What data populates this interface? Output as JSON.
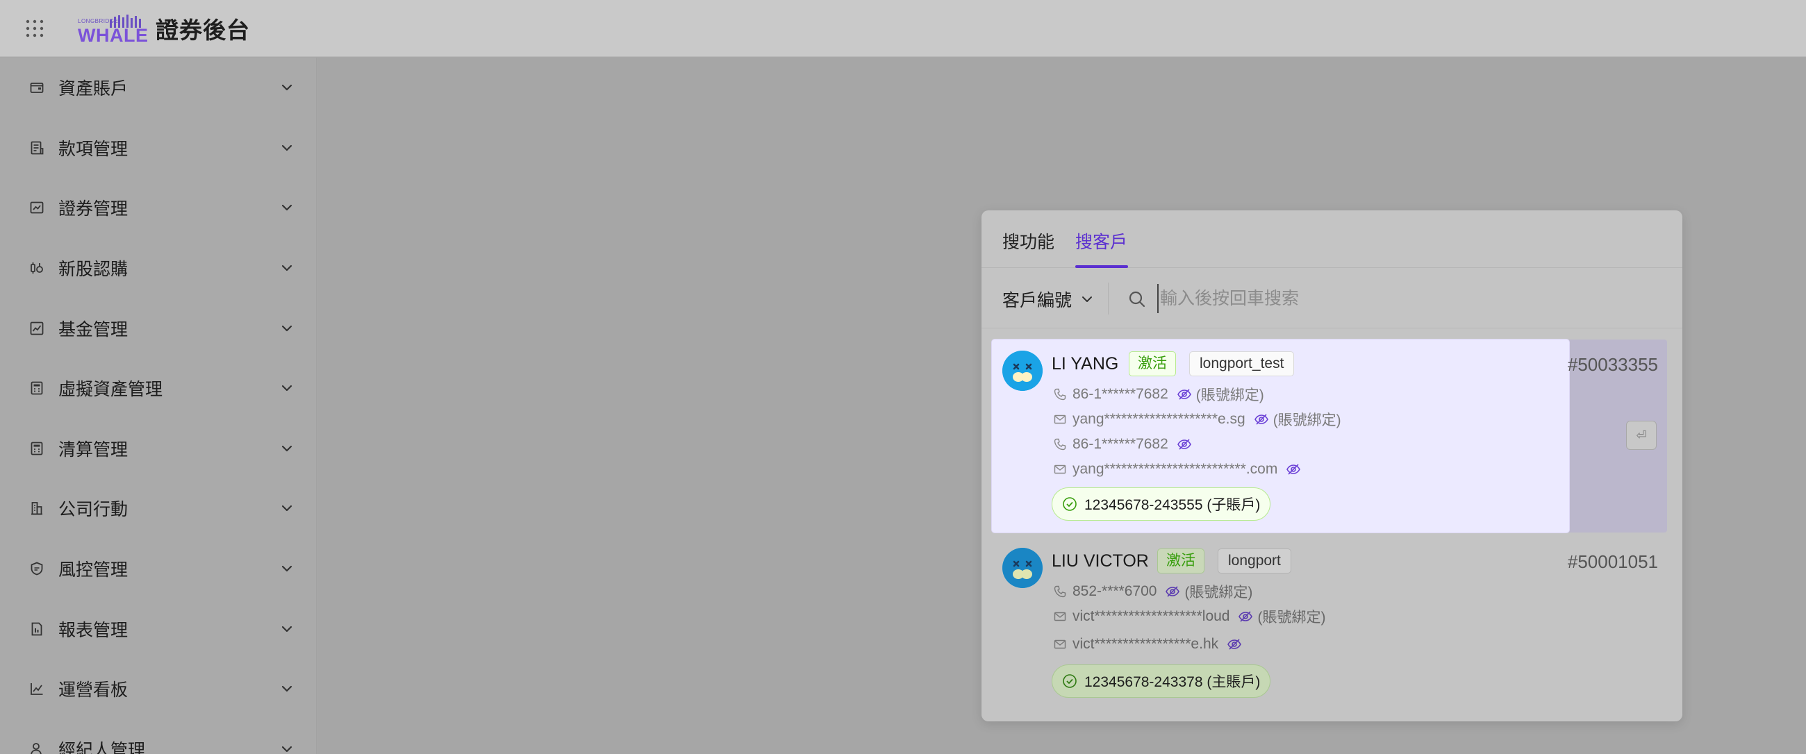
{
  "header": {
    "logo_small": "LONGBRIDGE",
    "logo_main": "WHALE",
    "title": "證券後台"
  },
  "sidebar": {
    "items": [
      {
        "label": "資產賬戶",
        "icon": "wallet-icon"
      },
      {
        "label": "款項管理",
        "icon": "receipt-icon"
      },
      {
        "label": "證券管理",
        "icon": "stock-card-icon"
      },
      {
        "label": "新股認購",
        "icon": "ipo-icon"
      },
      {
        "label": "基金管理",
        "icon": "fund-chart-icon"
      },
      {
        "label": "虛擬資產管理",
        "icon": "calculator-icon"
      },
      {
        "label": "清算管理",
        "icon": "calculator-icon"
      },
      {
        "label": "公司行動",
        "icon": "building-icon"
      },
      {
        "label": "風控管理",
        "icon": "shield-icon"
      },
      {
        "label": "報表管理",
        "icon": "report-icon"
      },
      {
        "label": "運營看板",
        "icon": "line-chart-icon"
      },
      {
        "label": "經紀人管理",
        "icon": "user-icon"
      }
    ]
  },
  "search_panel": {
    "tabs": [
      {
        "label": "搜功能",
        "active": false
      },
      {
        "label": "搜客戶",
        "active": true
      }
    ],
    "field_select": "客戶編號",
    "placeholder": "輸入後按回車搜索",
    "enter_hint": "⏎",
    "results": [
      {
        "name": "LI YANG",
        "status": "激活",
        "tag": "longport_test",
        "id": "#50033355",
        "lines": [
          {
            "type": "phone",
            "value": "86-1******7682",
            "note": "(賬號綁定)"
          },
          {
            "type": "email",
            "value": "yang********************e.sg",
            "note": "(賬號綁定)"
          },
          {
            "type": "phone",
            "value": "86-1******7682",
            "note": ""
          },
          {
            "type": "email",
            "value": "yang*************************.com",
            "note": ""
          }
        ],
        "account": "12345678-243555 (子賬戶)"
      },
      {
        "name": "LIU VICTOR",
        "status": "激活",
        "tag": "longport",
        "id": "#50001051",
        "lines": [
          {
            "type": "phone",
            "value": "852-****6700",
            "note": "(賬號綁定)"
          },
          {
            "type": "email",
            "value": "vict*******************loud",
            "note": "(賬號綁定)"
          },
          {
            "type": "email",
            "value": "vict*****************e.hk",
            "note": ""
          }
        ],
        "account": "12345678-243378 (主賬戶)"
      }
    ]
  },
  "colors": {
    "accent": "#5b2fd0",
    "tag_green": "#389e0d",
    "avatar_blue": "#1aa3e6"
  }
}
